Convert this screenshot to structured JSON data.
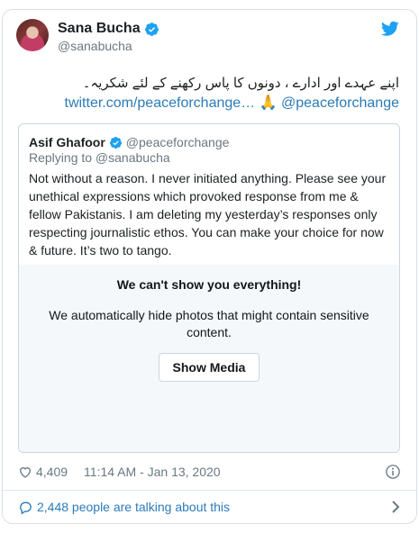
{
  "author": {
    "display_name": "Sana Bucha",
    "handle": "@sanabucha"
  },
  "tweet": {
    "text": "اپنے عہدے اور ادارے ، دونوں کا پاس رکھنے کے لئے شکریہ۔",
    "link_text": "twitter.com/peaceforchange…",
    "emoji": "🙏",
    "mention": "@peaceforchange"
  },
  "quoted": {
    "display_name": "Asif Ghafoor",
    "handle": "@peaceforchange",
    "replying_to": "Replying to @sanabucha",
    "text": "Not without a reason. I never initiated anything. Please see your unethical expressions which provoked response from me & fellow Pakistanis. I am deleting my yesterday’s responses only respecting journalistic ethos. You can make your choice for now & future. It’s two to tango."
  },
  "sensitive": {
    "title": "We can't show you everything!",
    "description": "We automatically hide photos that might contain sensitive content.",
    "button_label": "Show Media"
  },
  "meta": {
    "likes": "4,409",
    "timestamp": "11:14 AM - Jan 13, 2020"
  },
  "footer": {
    "talking_text": "2,448 people are talking about this"
  },
  "colors": {
    "link": "#2b7bb9",
    "verified": "#1da1f2",
    "twitter_blue": "#1da1f2",
    "muted": "#697882",
    "media_bg": "#f5f8fa"
  },
  "icons": [
    "verified-badge-icon",
    "twitter-bird-icon",
    "heart-icon",
    "info-icon",
    "speech-bubble-icon",
    "chevron-right-icon"
  ]
}
